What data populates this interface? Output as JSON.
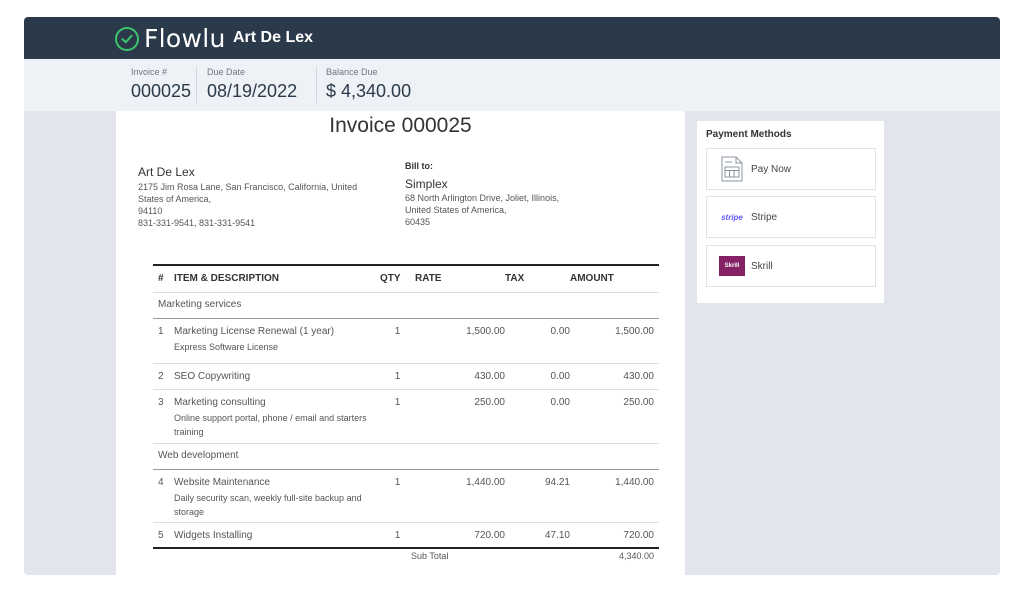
{
  "header": {
    "brand": "Flowlu",
    "company": "Art De Lex"
  },
  "summary": [
    {
      "label": "Invoice #",
      "value": "000025"
    },
    {
      "label": "Due Date",
      "value": "08/19/2022"
    },
    {
      "label": "Balance Due",
      "value": "$ 4,340.00"
    }
  ],
  "invoice": {
    "title": "Invoice 000025",
    "from": {
      "name": "Art De Lex",
      "address1": "2175 Jim Rosa Lane, San Francisco, California, United",
      "address2": "States of America,",
      "zip": "94110",
      "phone": "831-331-9541, 831-331-9541"
    },
    "bill_to": {
      "label": "Bill to:",
      "name": "Simplex",
      "address1": "68 North Arlington Drive, Joliet, Illinois,",
      "address2": "United States of America,",
      "zip": "60435"
    },
    "columns": {
      "num": "#",
      "item": "ITEM & DESCRIPTION",
      "qty": "QTY",
      "rate": "RATE",
      "tax": "TAX",
      "amount": "AMOUNT"
    },
    "sections": [
      {
        "name": "Marketing services"
      },
      {
        "name": "Web development"
      }
    ],
    "items": [
      {
        "num": "1",
        "name": "Marketing License Renewal (1 year)",
        "desc": "Express Software License",
        "qty": "1",
        "rate": "1,500.00",
        "tax": "0.00",
        "amount": "1,500.00"
      },
      {
        "num": "2",
        "name": "SEO Copywriting",
        "desc": "",
        "qty": "1",
        "rate": "430.00",
        "tax": "0.00",
        "amount": "430.00"
      },
      {
        "num": "3",
        "name": "Marketing consulting",
        "desc": "Online support portal, phone / email and starters training",
        "qty": "1",
        "rate": "250.00",
        "tax": "0.00",
        "amount": "250.00"
      },
      {
        "num": "4",
        "name": "Website Maintenance",
        "desc": "Daily security scan, weekly full-site backup and storage",
        "qty": "1",
        "rate": "1,440.00",
        "tax": "94.21",
        "amount": "1,440.00"
      },
      {
        "num": "5",
        "name": "Widgets Installing",
        "desc": "",
        "qty": "1",
        "rate": "720.00",
        "tax": "47.10",
        "amount": "720.00"
      }
    ],
    "subtotal": {
      "label": "Sub Total",
      "value": "4,340.00"
    }
  },
  "payment_methods": {
    "title": "Payment Methods",
    "items": [
      {
        "label": "Pay Now",
        "icon": "calculator-icon"
      },
      {
        "label": "Stripe",
        "icon": "stripe-logo",
        "logo_text": "stripe"
      },
      {
        "label": "Skrill",
        "icon": "skrill-logo",
        "logo_text": "Skrill"
      }
    ]
  },
  "colors": {
    "topbar": "#2b3a4a",
    "brand_green": "#3ec46d",
    "stripe": "#635bff",
    "skrill": "#862165"
  }
}
